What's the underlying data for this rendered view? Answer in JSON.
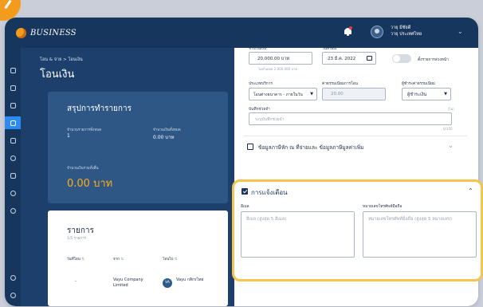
{
  "topbar": {
    "brand": "BUSINESS",
    "user_name": "วายุ มีชัยดี",
    "user_company": "วายุ ประเทศไทย"
  },
  "header": {
    "breadcrumb": "โอน & จ่าย > โอนเงิน",
    "title": "โอนเงิน"
  },
  "summary": {
    "title": "สรุปการทำรายการ",
    "count_label": "จำนวนรายการทั้งหมด",
    "count_value": "1",
    "amount_label": "จำนวนเงินทั้งหมด",
    "amount_value": "0.00 บาท",
    "total_label": "จำนวนเงินรวมทั้งสิ้น",
    "total_value": "0.00 บาท"
  },
  "list": {
    "title": "รายการ",
    "subtitle": "1/5 รายการ",
    "columns": [
      "วันที่โอน",
      "จาก",
      "โอนไป"
    ],
    "row": {
      "date": "-",
      "from": "Vayu Company Limited",
      "avatar": "VA",
      "to": "Vayu กสิกรไทย"
    }
  },
  "form": {
    "amount_label": "จำนวนเงิน",
    "amount_value": "20,000.00 บาท",
    "amount_hint": "ไม่เกินยอด 2,000,000 บาท",
    "date_label": "วันที่โอน",
    "date_value": "23 มี.ค. 2022",
    "recurring_label": "ตั้งรายการล่วงหน้า",
    "service_label": "ประเภทบริการ",
    "service_value": "โอนต่างธนาคาร - ภายในวัน",
    "fee_label": "ค่าธรรมเนียมการโอน",
    "fee_value": "20.00",
    "payer_label": "ผู้ชำระค่าธรรมเนียม",
    "payer_value": "ผู้ชำระเงิน",
    "note_label": "บันทึกช่วยจำ",
    "note_placeholder": "ระบุบันทึกช่วยจำ",
    "note_optional": "(ไม่)",
    "note_counter": "0/150",
    "deduction_label": "ข้อมูลภาษีหัก ณ ที่จ่ายและ ข้อมูลภาษีมูลค่าเพิ่ม"
  },
  "notification": {
    "title": "การแจ้งเตือน",
    "email_label": "อีเมล",
    "email_placeholder": "อีเมล (สูงสุด 5 อีเมล)",
    "phone_label": "หมายเลขโทรศัพท์มือถือ",
    "phone_placeholder": "หมายเลขโทรศัพท์มือถือ (สูงสุด 5 หมายเลข)"
  },
  "colors": {
    "navy": "#16365d",
    "accent_blue": "#2c8af0",
    "orange": "#ffae17",
    "highlight": "#f5c350"
  }
}
